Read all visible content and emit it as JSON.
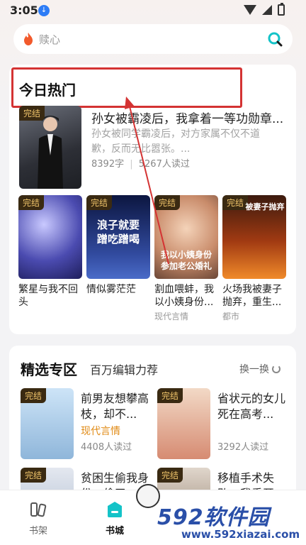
{
  "status_bar": {
    "time": "3:05"
  },
  "search": {
    "placeholder": "赎心"
  },
  "hot": {
    "title": "今日热门",
    "featured": {
      "badge": "完结",
      "title": "孙女被霸凌后，我拿着一等功勋章...",
      "desc": "孙女被同学霸凌后，对方家属不仅不道歉，反而无比嚣张。...",
      "words": "8392字",
      "reads": "5267人读过"
    },
    "books": [
      {
        "badge": "完结",
        "title": "繁星与我不回头",
        "tag": ""
      },
      {
        "badge": "完结",
        "title": "情似雾茫茫",
        "tag": "",
        "cover_text": "浪子就要 蹭吃蹭喝"
      },
      {
        "badge": "完结",
        "title": "割血喂蚌，我以小姨身份...",
        "tag": "现代言情",
        "cover_text": "我以小姨身份参加老公婚礼"
      },
      {
        "badge": "完结",
        "title": "火场我被妻子抛弃，重生...",
        "tag": "都市",
        "cover_text": "被妻子抛弃"
      }
    ]
  },
  "picks": {
    "title": "精选专区",
    "subtitle": "百万编辑力荐",
    "refresh": "换一换",
    "items": [
      {
        "badge": "完结",
        "title": "前男友想攀高枝，却不...",
        "genre": "现代言情",
        "reads": "4408人读过"
      },
      {
        "badge": "完结",
        "title": "省状元的女儿死在高考...",
        "genre": "",
        "reads": "3292人读过"
      },
      {
        "badge": "完结",
        "title": "贫困生偷我身份，偷了...",
        "genre": "",
        "reads": ""
      },
      {
        "badge": "完结",
        "title": "移植手术失败，我重开...",
        "genre": "",
        "reads": ""
      }
    ]
  },
  "tabs": [
    {
      "label": "书架"
    },
    {
      "label": "书城"
    }
  ],
  "watermark": {
    "brand": "592软件园",
    "url": "www.592xiazai.com"
  },
  "colors": {
    "highlight_box": "#d43333",
    "badge_bg": "#3a2a12",
    "badge_text": "#f1c56b",
    "genre": "#e08a14",
    "accent": "#14c3c8"
  }
}
